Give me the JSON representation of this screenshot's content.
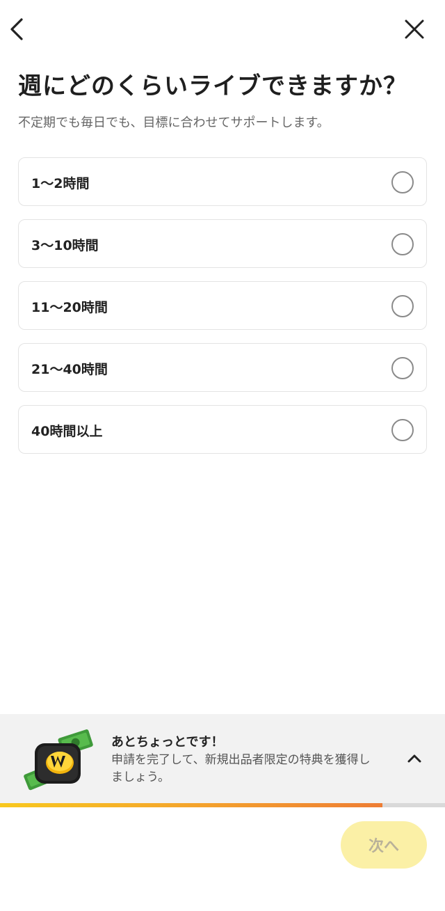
{
  "header": {
    "back_icon": "chevron-left-icon",
    "close_icon": "close-icon"
  },
  "question": {
    "title": "週にどのくらいライブできますか？",
    "subtitle": "不定期でも毎日でも、目標に合わせてサポートします。"
  },
  "options": [
    {
      "label": "1〜2時間",
      "selected": false
    },
    {
      "label": "3〜10時間",
      "selected": false
    },
    {
      "label": "11〜20時間",
      "selected": false
    },
    {
      "label": "21〜40時間",
      "selected": false
    },
    {
      "label": "40時間以上",
      "selected": false
    }
  ],
  "banner": {
    "title": "あとちょっとです！",
    "body": "申請を完了して、新規出品者限定の特典を獲得しましょう。",
    "icon": "wallet-money-icon",
    "toggle_icon": "chevron-up-icon"
  },
  "progress": {
    "fraction": 0.86
  },
  "footer": {
    "next_label": "次へ"
  },
  "colors": {
    "accent_yellow": "#f8c81e",
    "accent_orange": "#ee7d34",
    "button_disabled_bg": "#fbf0a6",
    "button_disabled_text": "#b9b199"
  }
}
